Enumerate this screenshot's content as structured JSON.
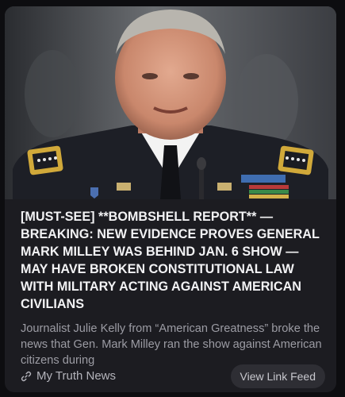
{
  "card": {
    "headline": "[MUST-SEE] **BOMBSHELL REPORT** — BREAKING: NEW EVIDENCE PROVES GENERAL MARK MILLEY WAS BEHIND JAN. 6 SHOW — MAY HAVE BROKEN CONSTITUTIONAL LAW WITH MILITARY ACTING AGAINST AMERICAN CIVILIANS",
    "summary": "Journalist Julie Kelly from “American Greatness” broke the news that Gen. Mark Milley ran the show against American citizens during",
    "source_name": "My Truth News",
    "source_icon": "link-icon",
    "feed_button": "View Link Feed"
  },
  "colors": {
    "page_bg": "#0d0d10",
    "card_bg": "#1c1c21",
    "headline": "#f2f2f4",
    "summary": "#9c9ca4",
    "button_bg": "#2e2e34"
  }
}
